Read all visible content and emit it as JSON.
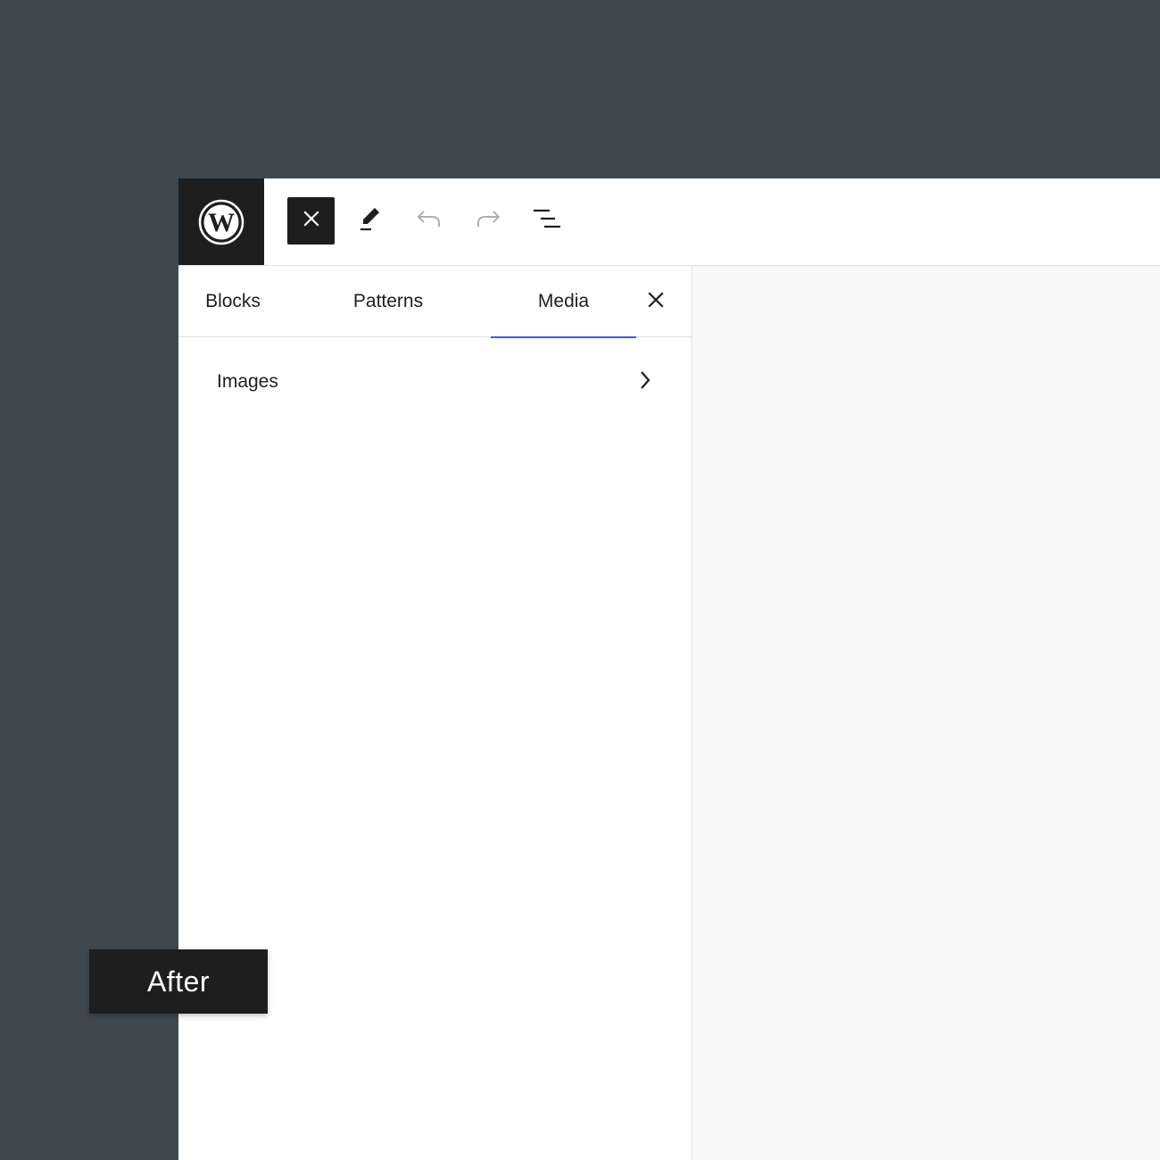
{
  "colors": {
    "backdrop": "#3f474f",
    "dark": "#1e1e1e",
    "accent": "#3858e9",
    "canvas": "#f8f8f8"
  },
  "toolbar": {
    "logo_icon": "wordpress-logo-icon",
    "toggle_icon": "close-icon",
    "tools": [
      {
        "name": "edit-tool",
        "icon": "pencil-icon"
      },
      {
        "name": "undo",
        "icon": "undo-icon",
        "disabled": true
      },
      {
        "name": "redo",
        "icon": "redo-icon",
        "disabled": true
      },
      {
        "name": "document-overview",
        "icon": "list-view-icon"
      }
    ]
  },
  "inserter": {
    "tabs": [
      {
        "label": "Blocks",
        "active": false
      },
      {
        "label": "Patterns",
        "active": false
      },
      {
        "label": "Media",
        "active": true
      }
    ],
    "close_icon": "close-icon",
    "media_categories": [
      {
        "label": "Images",
        "icon": "chevron-right-icon"
      }
    ]
  },
  "badge": {
    "label": "After"
  }
}
